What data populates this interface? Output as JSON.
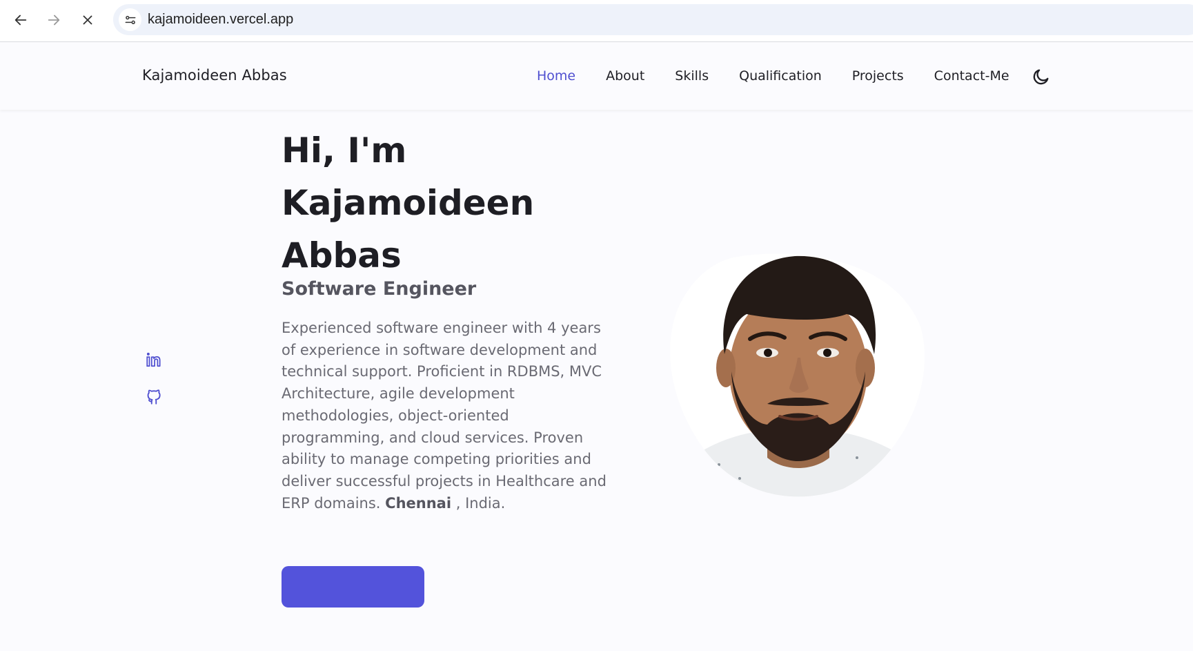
{
  "browser": {
    "url": "kajamoideen.vercel.app",
    "icons": [
      "back-arrow-icon",
      "forward-arrow-icon",
      "close-icon",
      "site-settings-icon"
    ]
  },
  "header": {
    "brand": "Kajamoideen Abbas",
    "menu": [
      {
        "label": "Home",
        "active": true
      },
      {
        "label": "About"
      },
      {
        "label": "Skills"
      },
      {
        "label": "Qualification"
      },
      {
        "label": "Projects"
      },
      {
        "label": "Contact-Me"
      }
    ],
    "theme_icon": "moon-icon"
  },
  "hero": {
    "title_line1": "Hi, I'm",
    "title_line2": "Kajamoideen",
    "title_line3": "Abbas",
    "subtitle": "Software Engineer",
    "description": "Experienced software engineer with 4 years of experience in software development and technical support. Proficient in RDBMS, MVC Architecture, agile development methodologies, object-oriented programming, and cloud services. Proven ability to manage competing priorities and deliver successful projects in Healthcare and ERP domains.",
    "city": "Chennai",
    "country": ", India."
  },
  "social": [
    "linkedin-icon",
    "github-icon"
  ],
  "colors": {
    "accent": "#5353db",
    "background": "#fbfbfe",
    "text": "#1e1e24"
  }
}
